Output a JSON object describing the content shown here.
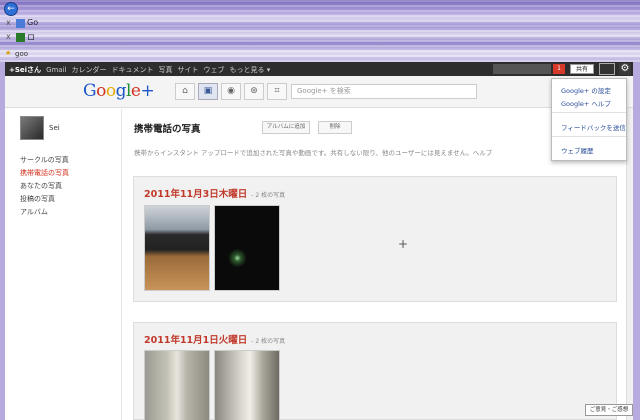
{
  "browser": {
    "back_glyph": "←",
    "tabs": [
      {
        "close": "x",
        "label": "Go"
      },
      {
        "close": "x",
        "label": "ロ"
      },
      {
        "close": "x",
        "label": ""
      }
    ],
    "bookmark_label": "goo"
  },
  "gbar": {
    "items": [
      "+Seiさん",
      "Gmail",
      "カレンダー",
      "ドキュメント",
      "写真",
      "サイト",
      "ウェブ",
      "もっと見る ▾"
    ],
    "notification_count": "1",
    "share_label": "共有",
    "gear_glyph": "⚙"
  },
  "header": {
    "logo": {
      "g": "G",
      "o1": "o",
      "o2": "o",
      "g2": "g",
      "l": "l",
      "e": "e",
      "plus": "+"
    },
    "nav_icons": [
      "⌂",
      "▣",
      "◉",
      "⊛",
      "⌗"
    ],
    "search_placeholder": "Google+ を検索"
  },
  "settings_menu": {
    "items": [
      "Google+ の設定",
      "Google+ ヘルプ",
      "フィードバックを送信",
      "ウェブ履歴"
    ]
  },
  "sidebar": {
    "profile_name": "Sei",
    "links": [
      "サークルの写真",
      "携帯電話の写真",
      "あなたの写真",
      "投稿の写真",
      "アルバム"
    ],
    "active_index": 1
  },
  "main": {
    "title": "携帯電話の写真",
    "add_to_album": "アルバムに追加",
    "delete": "削除",
    "description": "携帯からインスタント アップロードで追加された写真や動画です。共有しない限り、他のユーザーには見えません。ヘルプ",
    "albums": [
      {
        "date": "2011年11月3日木曜日",
        "count": "- 2 枚の写真"
      },
      {
        "date": "2011年11月1日火曜日",
        "count": "- 2 枚の写真"
      }
    ],
    "plus_glyph": "+"
  },
  "status": {
    "label": "ご意見・ご感想"
  },
  "colors": {
    "accent_red": "#d2321e",
    "link_blue": "#2a4e9a",
    "gbar_bg": "#2d2d2d"
  }
}
